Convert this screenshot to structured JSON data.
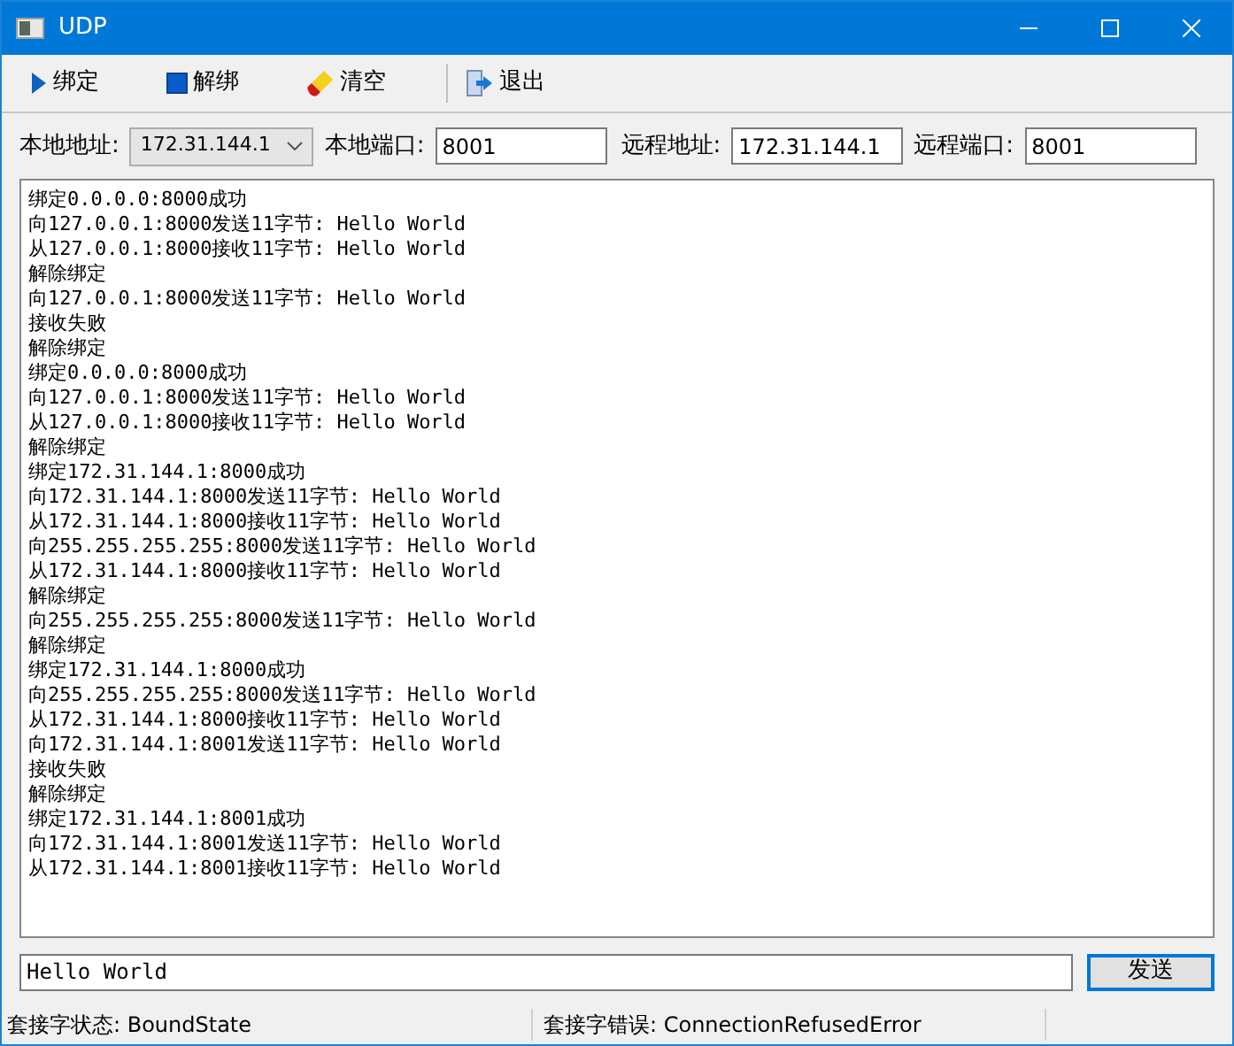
{
  "window": {
    "title": "UDP"
  },
  "toolbar": [
    {
      "kind": "bind",
      "label": "绑定"
    },
    {
      "kind": "unbind",
      "label": "解绑"
    },
    {
      "kind": "clear",
      "label": "清空"
    },
    {
      "kind": "exit",
      "label": "退出"
    }
  ],
  "form": {
    "local_address_label": "本地地址:",
    "local_address": "172.31.144.1",
    "local_port_label": "本地端口:",
    "local_port": "8001",
    "remote_address_label": "远程地址:",
    "remote_address": "172.31.144.1",
    "remote_port_label": "远程端口:",
    "remote_port": "8001"
  },
  "log": [
    "绑定0.0.0.0:8000成功",
    "向127.0.0.1:8000发送11字节: Hello World",
    "从127.0.0.1:8000接收11字节: Hello World",
    "解除绑定",
    "向127.0.0.1:8000发送11字节: Hello World",
    "接收失败",
    "解除绑定",
    "绑定0.0.0.0:8000成功",
    "向127.0.0.1:8000发送11字节: Hello World",
    "从127.0.0.1:8000接收11字节: Hello World",
    "解除绑定",
    "绑定172.31.144.1:8000成功",
    "向172.31.144.1:8000发送11字节: Hello World",
    "从172.31.144.1:8000接收11字节: Hello World",
    "向255.255.255.255:8000发送11字节: Hello World",
    "从172.31.144.1:8000接收11字节: Hello World",
    "解除绑定",
    "向255.255.255.255:8000发送11字节: Hello World",
    "解除绑定",
    "绑定172.31.144.1:8000成功",
    "向255.255.255.255:8000发送11字节: Hello World",
    "从172.31.144.1:8000接收11字节: Hello World",
    "向172.31.144.1:8001发送11字节: Hello World",
    "接收失败",
    "解除绑定",
    "绑定172.31.144.1:8001成功",
    "向172.31.144.1:8001发送11字节: Hello World",
    "从172.31.144.1:8001接收11字节: Hello World"
  ],
  "message": {
    "value": "Hello World",
    "send_label": "发送"
  },
  "status_bar": [
    "套接字状态: BoundState",
    "套接字错误: ConnectionRefusedError"
  ]
}
